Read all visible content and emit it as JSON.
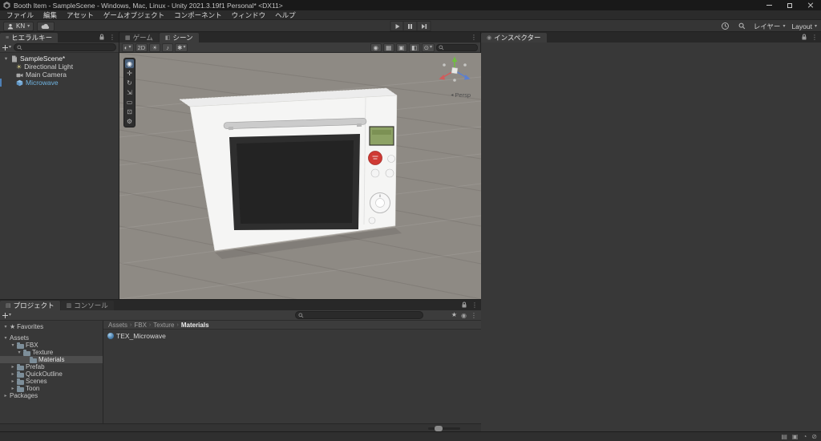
{
  "window": {
    "title": "Booth Item - SampleScene - Windows, Mac, Linux - Unity 2021.3.19f1 Personal* <DX11>"
  },
  "menu": {
    "items": [
      "ファイル",
      "編集",
      "アセット",
      "ゲームオブジェクト",
      "コンポーネント",
      "ウィンドウ",
      "ヘルプ"
    ]
  },
  "toolbar": {
    "account": "KN",
    "layers": "レイヤー",
    "layout": "Layout"
  },
  "hierarchy": {
    "tab": "ヒエラルキー",
    "rows": [
      {
        "label": "SampleScene*"
      },
      {
        "label": "Directional Light"
      },
      {
        "label": "Main Camera"
      },
      {
        "label": "Microwave"
      }
    ]
  },
  "scene": {
    "tab_game": "ゲーム",
    "tab_scene": "シーン",
    "persp": "Persp",
    "label_2d": "2D"
  },
  "inspector": {
    "tab": "インスペクター"
  },
  "project": {
    "tab_project": "プロジェクト",
    "tab_console": "コンソール",
    "tree": [
      {
        "label": "Favorites",
        "arrow": "▾"
      },
      {
        "label": "Assets",
        "arrow": "▾"
      },
      {
        "label": "FBX",
        "arrow": "▾"
      },
      {
        "label": "Texture",
        "arrow": "▾"
      },
      {
        "label": "Materials",
        "arrow": ""
      },
      {
        "label": "Prefab",
        "arrow": "▸"
      },
      {
        "label": "QuickOutline",
        "arrow": "▸"
      },
      {
        "label": "Scenes",
        "arrow": "▸"
      },
      {
        "label": "Toon",
        "arrow": "▸"
      },
      {
        "label": "Packages",
        "arrow": "▸"
      }
    ],
    "breadcrumb": [
      "Assets",
      "FBX",
      "Texture",
      "Materials"
    ],
    "crumb_sep": "›",
    "items": [
      {
        "name": "TEX_Microwave"
      }
    ]
  },
  "icons": {
    "hamburger": "≡",
    "kebab": "⋮",
    "dropdown": "▾",
    "foldout_open": "▾",
    "sun": "☀",
    "star": "★",
    "audio": "♪",
    "fx": "✱",
    "shaded": "◐",
    "grid": "▦",
    "overlay": "▣",
    "eye": "◉",
    "half": "◧",
    "gizmo": "⊙",
    "persp_arrow": "◂",
    "tab_game": "▦",
    "tab_scene": "◧",
    "tab_inspector": "◉",
    "tab_project": "▤",
    "tab_console": "▥",
    "tools": [
      "◉",
      "✛",
      "↻",
      "⇲",
      "▭",
      "⊡",
      "⚙"
    ],
    "status": [
      "▤",
      "▣",
      "◔",
      "⊘"
    ]
  },
  "colors": {
    "scene_background": "#8e8a84",
    "selection_blue": "#4e7fb5",
    "prefab_text": "#6fb3e0",
    "lcd_green": "#8da265",
    "button_red": "#cf3a34",
    "axis_x_red": "#d25b5b",
    "axis_y_green": "#6fbf3f",
    "axis_z_blue": "#5b7fd2"
  }
}
